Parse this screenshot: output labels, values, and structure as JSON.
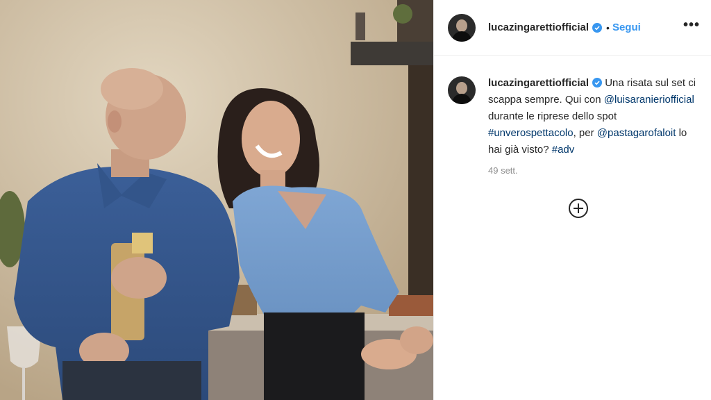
{
  "post": {
    "username": "lucazingarettiofficial",
    "follow_label": "Segui",
    "separator": "•",
    "more_label": "•••",
    "caption": {
      "username": "lucazingarettiofficial",
      "part1": " Una risata sul set ci scappa sempre. Qui con ",
      "mention1": "@luisaranieriofficial",
      "part2": " durante le riprese dello spot ",
      "hashtag1": "#unverospettacolo",
      "part3": ", per ",
      "mention2": "@pastagarofaloit",
      "part4": " lo hai già visto? ",
      "hashtag2": "#adv"
    },
    "timestamp": "49 sett.",
    "icons": {
      "verified": "verified-badge-icon",
      "more": "more-options-icon",
      "add_comment": "plus-circle-icon"
    },
    "colors": {
      "accent": "#3897f0",
      "link": "#00376b",
      "muted": "#8e8e8e"
    }
  }
}
